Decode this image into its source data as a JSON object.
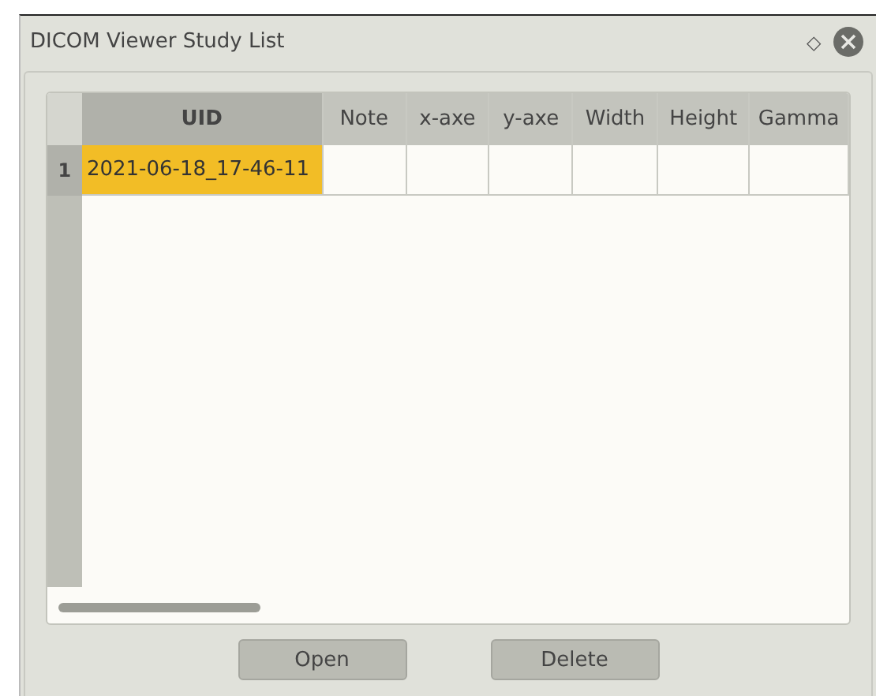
{
  "window": {
    "title": "DICOM Viewer Study List",
    "title_buttons": [
      "◇"
    ]
  },
  "table": {
    "columns": [
      {
        "label": "UID",
        "selected": true
      },
      {
        "label": "Note",
        "selected": false
      },
      {
        "label": "x-axe",
        "selected": false
      },
      {
        "label": "y-axe",
        "selected": false
      },
      {
        "label": "Width",
        "selected": false
      },
      {
        "label": "Height",
        "selected": false
      },
      {
        "label": "Gamma",
        "selected": false
      }
    ],
    "rows": [
      {
        "number": "1",
        "selected": false,
        "cells": [
          {
            "text": "2021-06-18_17-46-11",
            "selected": true
          },
          {
            "text": "",
            "selected": false
          },
          {
            "text": "",
            "selected": false
          },
          {
            "text": "",
            "selected": false
          },
          {
            "text": "",
            "selected": false
          },
          {
            "text": "",
            "selected": false
          },
          {
            "text": "",
            "selected": false
          }
        ]
      }
    ]
  },
  "buttons": [
    "Open",
    "Delete"
  ]
}
